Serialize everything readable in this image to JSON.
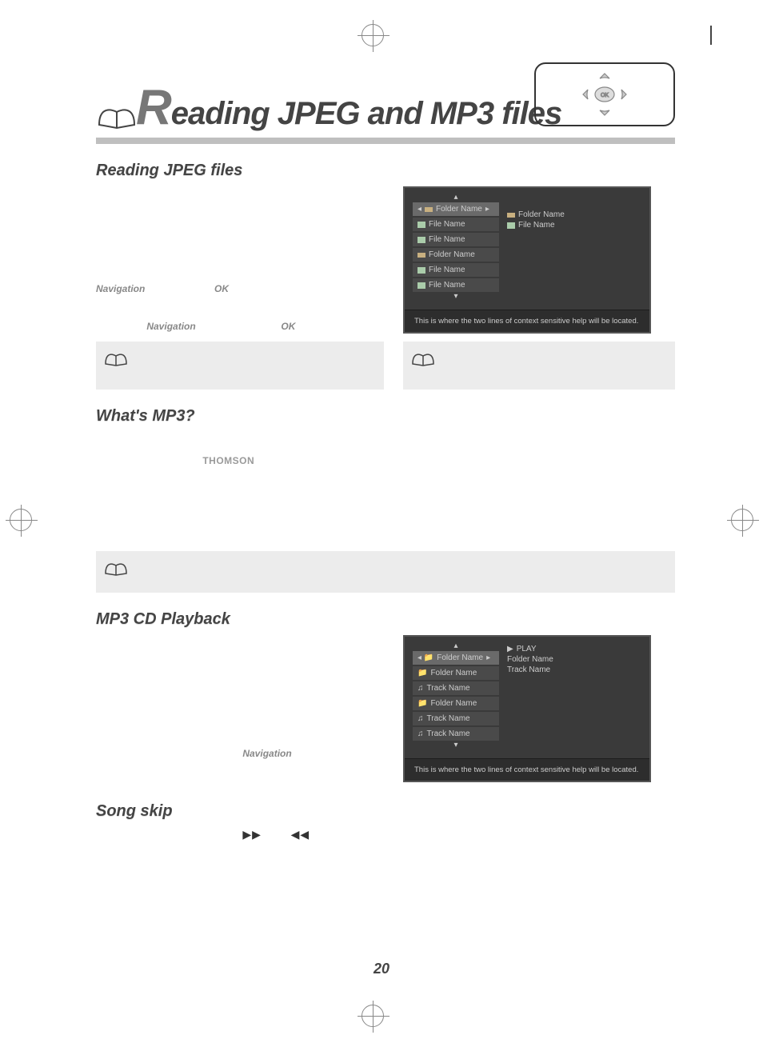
{
  "page_title": "Reading JPEG and MP3 files",
  "sections": {
    "jpeg": {
      "heading": "Reading JPEG files"
    },
    "mp3_what": {
      "heading": "What's MP3?"
    },
    "mp3_play": {
      "heading": "MP3 CD Playback"
    },
    "skip": {
      "heading": "Song skip"
    }
  },
  "labels": {
    "nav1": "Navigation",
    "ok1": "OK",
    "nav2": "Navigation",
    "ok2": "OK",
    "nav3": "Navigation",
    "thomson": "THOMSON"
  },
  "skip_symbols": {
    "fwd": "▶▶",
    "rew": "◀◀"
  },
  "screenshot1": {
    "left": [
      "Folder Name",
      "File Name",
      "File Name",
      "Folder Name",
      "File Name",
      "File Name"
    ],
    "right": [
      "Folder Name",
      "File Name"
    ],
    "help": "This is where the two lines of context sensitive help will be located."
  },
  "screenshot2": {
    "left": [
      "Folder Name",
      "Folder Name",
      "Track Name",
      "Folder Name",
      "Track Name",
      "Track Name"
    ],
    "right_status": "PLAY",
    "right_lines": [
      "Folder Name",
      "Track Name"
    ],
    "help": "This is where the two lines of context sensitive help will be located."
  },
  "page_number": "20"
}
